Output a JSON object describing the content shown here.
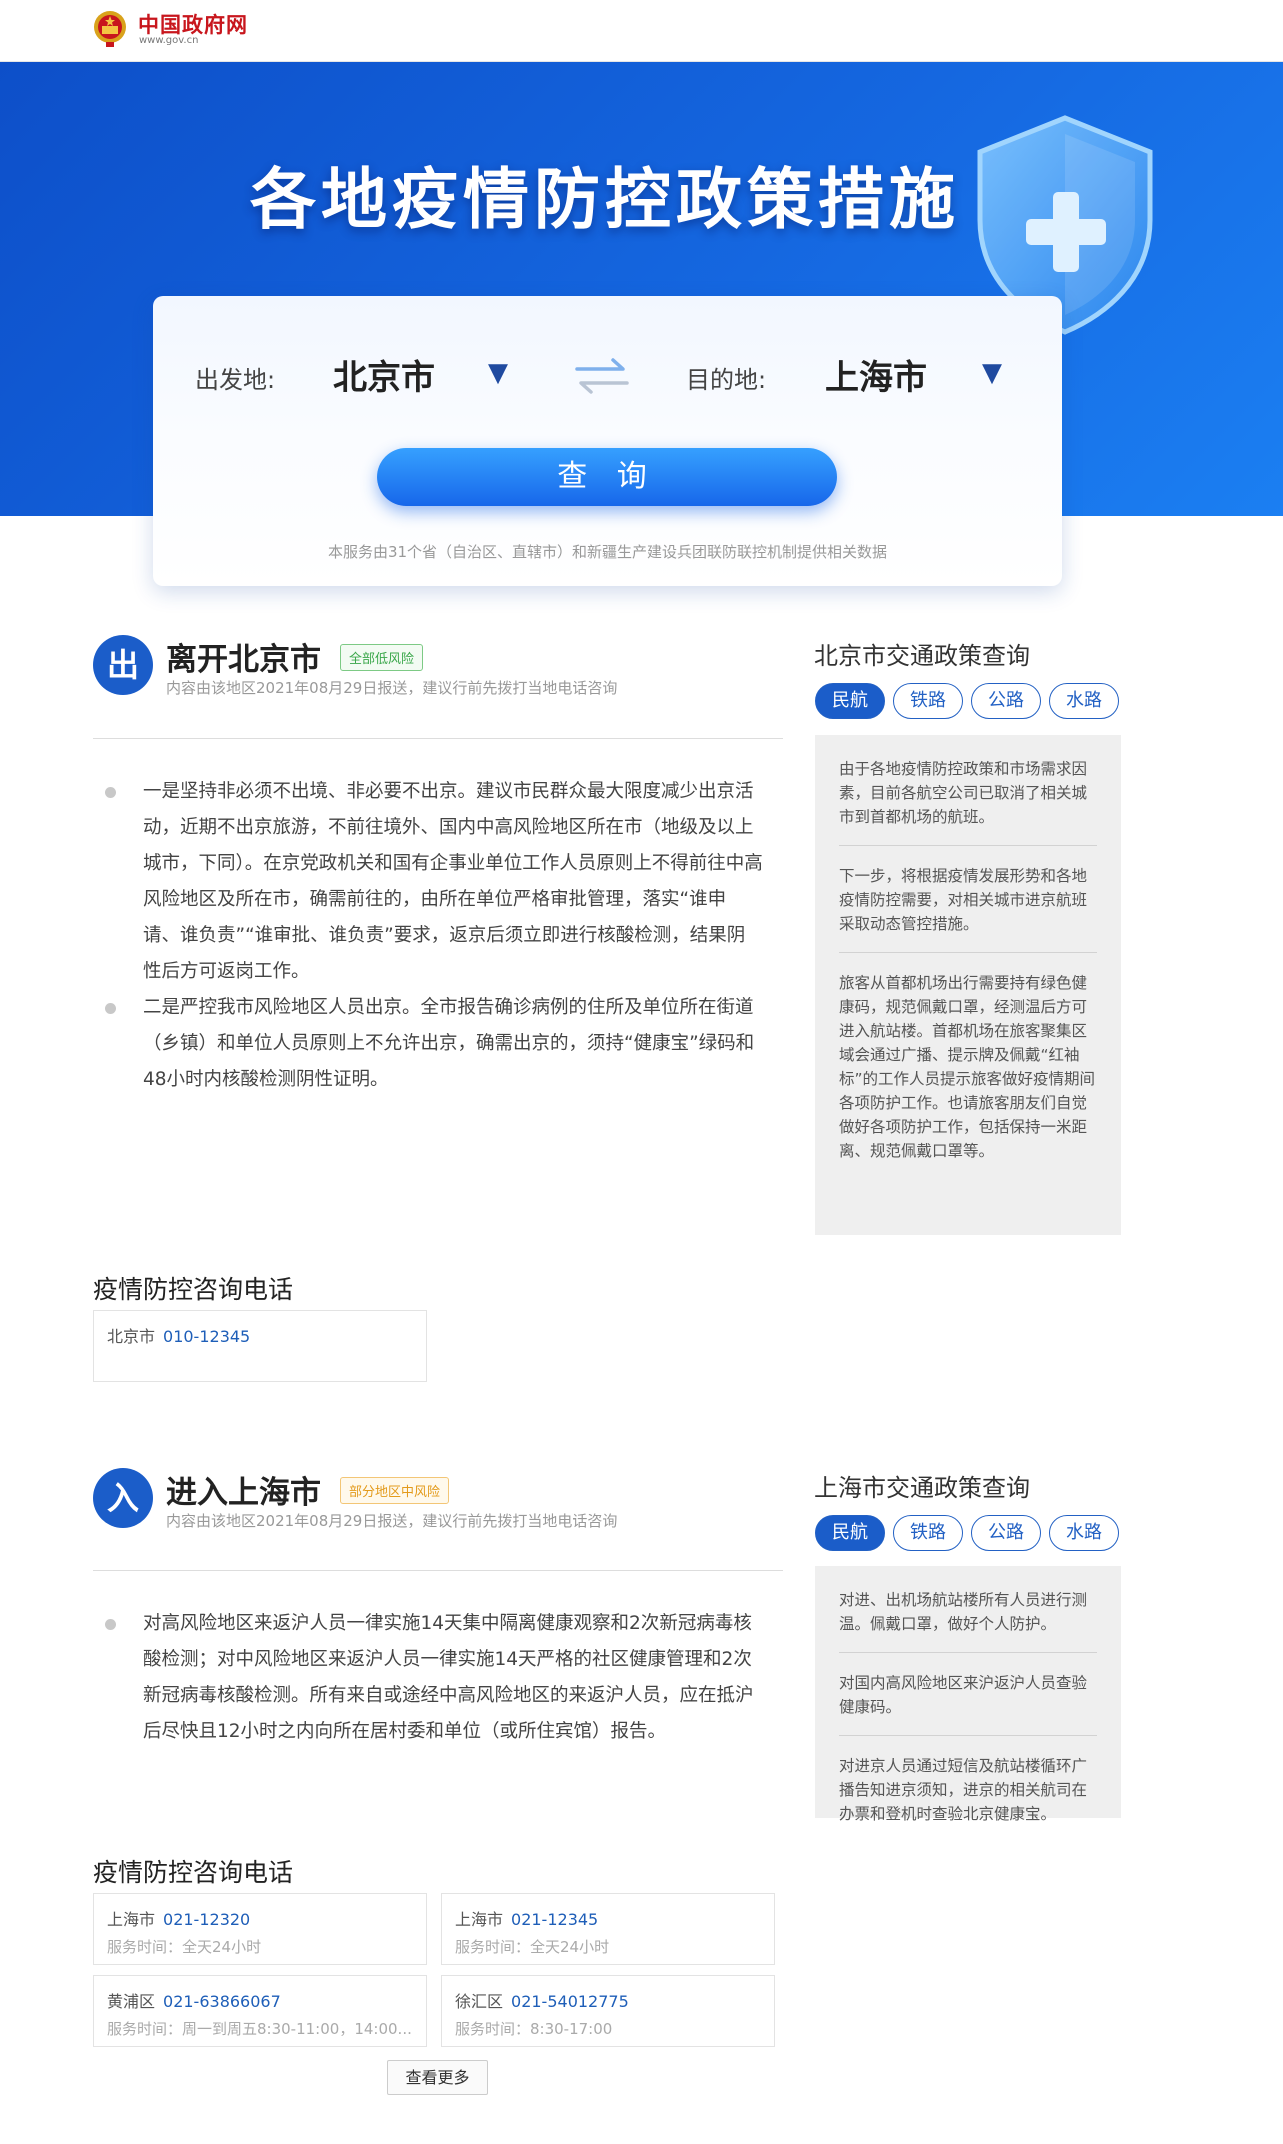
{
  "header": {
    "site_name": "中国政府网",
    "site_url": "www.gov.cn"
  },
  "hero": {
    "title": "各地疫情防控政策措施"
  },
  "search": {
    "from_label": "出发地:",
    "from_city": "北京市",
    "to_label": "目的地:",
    "to_city": "上海市",
    "query_label": "查 询",
    "note": "本服务由31个省（自治区、直辖市）和新疆生产建设兵团联防联控机制提供相关数据"
  },
  "leave": {
    "icon": "出",
    "title": "离开北京市",
    "risk": "全部低风险",
    "subtitle": "内容由该地区2021年08月29日报送，建议行前先拨打当地电话咨询",
    "items": [
      "一是坚持非必须不出境、非必要不出京。建议市民群众最大限度减少出京活动，近期不出京旅游，不前往境外、国内中高风险地区所在市（地级及以上城市，下同）。在京党政机关和国有企事业单位工作人员原则上不得前往中高风险地区及所在市，确需前往的，由所在单位严格审批管理，落实“谁申请、谁负责”“谁审批、谁负责”要求，返京后须立即进行核酸检测，结果阴性后方可返岗工作。",
      "二是严控我市风险地区人员出京。全市报告确诊病例的住所及单位所在街道（乡镇）和单位人员原则上不允许出京，确需出京的，须持“健康宝”绿码和48小时内核酸检测阴性证明。"
    ],
    "phones_title": "疫情防控咨询电话",
    "phones": [
      {
        "city": "北京市",
        "number": "010-12345"
      }
    ]
  },
  "leave_side": {
    "title": "北京市交通政策查询",
    "tabs": [
      "民航",
      "铁路",
      "公路",
      "水路"
    ],
    "paragraphs": [
      "由于各地疫情防控政策和市场需求因素，目前各航空公司已取消了相关城市到首都机场的航班。",
      "下一步，将根据疫情发展形势和各地疫情防控需要，对相关城市进京航班采取动态管控措施。",
      "旅客从首都机场出行需要持有绿色健康码，规范佩戴口罩，经测温后方可进入航站楼。首都机场在旅客聚集区域会通过广播、提示牌及佩戴“红袖标”的工作人员提示旅客做好疫情期间各项防护工作。也请旅客朋友们自觉做好各项防护工作，包括保持一米距离、规范佩戴口罩等。"
    ]
  },
  "enter": {
    "icon": "入",
    "title": "进入上海市",
    "risk": "部分地区中风险",
    "subtitle": "内容由该地区2021年08月29日报送，建议行前先拨打当地电话咨询",
    "items": [
      "对高风险地区来返沪人员一律实施14天集中隔离健康观察和2次新冠病毒核酸检测；对中风险地区来返沪人员一律实施14天严格的社区健康管理和2次新冠病毒核酸检测。所有来自或途经中高风险地区的来返沪人员，应在抵沪后尽快且12小时之内向所在居村委和单位（或所住宾馆）报告。"
    ],
    "phones_title": "疫情防控咨询电话",
    "phones": [
      {
        "city": "上海市",
        "number": "021-12320",
        "hours": "服务时间：全天24小时"
      },
      {
        "city": "上海市",
        "number": "021-12345",
        "hours": "服务时间：全天24小时"
      },
      {
        "city": "黄浦区",
        "number": "021-63866067",
        "hours": "服务时间：周一到周五8:30-11:00，14:00..."
      },
      {
        "city": "徐汇区",
        "number": "021-54012775",
        "hours": "服务时间：8:30-17:00"
      }
    ],
    "more_label": "查看更多"
  },
  "enter_side": {
    "title": "上海市交通政策查询",
    "tabs": [
      "民航",
      "铁路",
      "公路",
      "水路"
    ],
    "paragraphs": [
      "对进、出机场航站楼所有人员进行测温。佩戴口罩，做好个人防护。",
      "对国内高风险地区来沪返沪人员查验健康码。",
      "对进京人员通过短信及航站楼循环广播告知进京须知，进京的相关航司在办票和登机时查验北京健康宝。"
    ]
  },
  "colors": {
    "brand": "#1b5dc9",
    "header_red": "#c8161d",
    "risk_low": "#3aa74a",
    "risk_mid": "#e39a1b"
  }
}
